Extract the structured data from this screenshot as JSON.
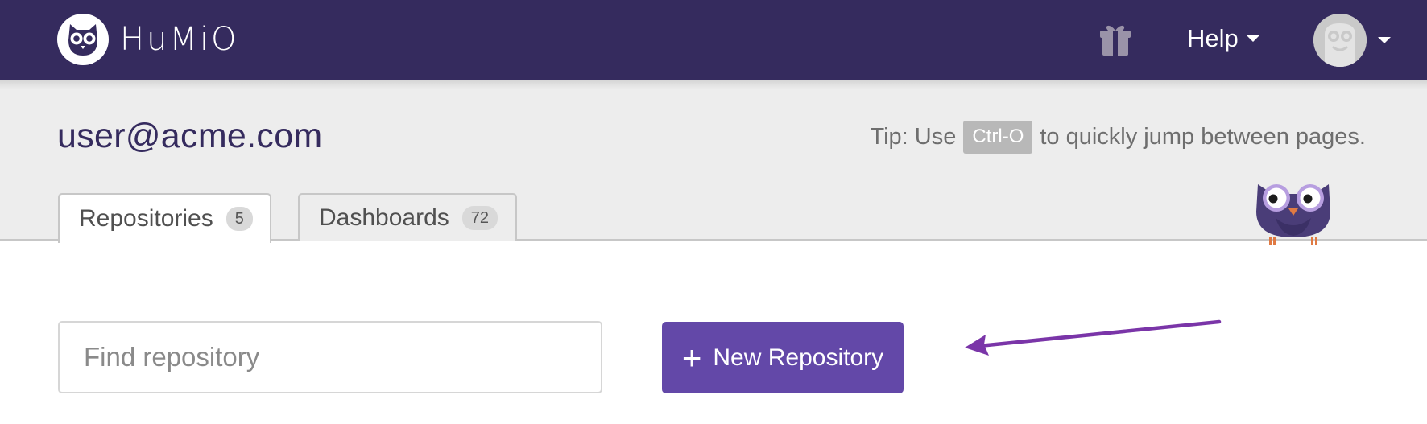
{
  "topbar": {
    "brand_name": "HuMiO",
    "help_label": "Help",
    "icons": {
      "logo": "owl-logo-icon",
      "gift": "gift-icon",
      "avatar": "owl-avatar-icon",
      "caret": "caret-down-icon"
    }
  },
  "header": {
    "user_email": "user@acme.com",
    "tip": {
      "prefix": "Tip: Use",
      "shortcut": "Ctrl-O",
      "suffix": "to quickly jump between pages."
    }
  },
  "tabs": [
    {
      "label": "Repositories",
      "count": "5",
      "active": true
    },
    {
      "label": "Dashboards",
      "count": "72",
      "active": false
    }
  ],
  "search": {
    "placeholder": "Find repository",
    "value": ""
  },
  "actions": {
    "new_repository_label": "New Repository",
    "plus_icon": "plus-icon"
  },
  "annotation": {
    "arrow_icon": "pointer-arrow-icon",
    "mascot_icon": "owl-mascot-icon"
  },
  "colors": {
    "topbar": "#352b5e",
    "header_band": "#ededed",
    "primary_button": "#6348a8",
    "annotation_arrow": "#7a35a8"
  }
}
